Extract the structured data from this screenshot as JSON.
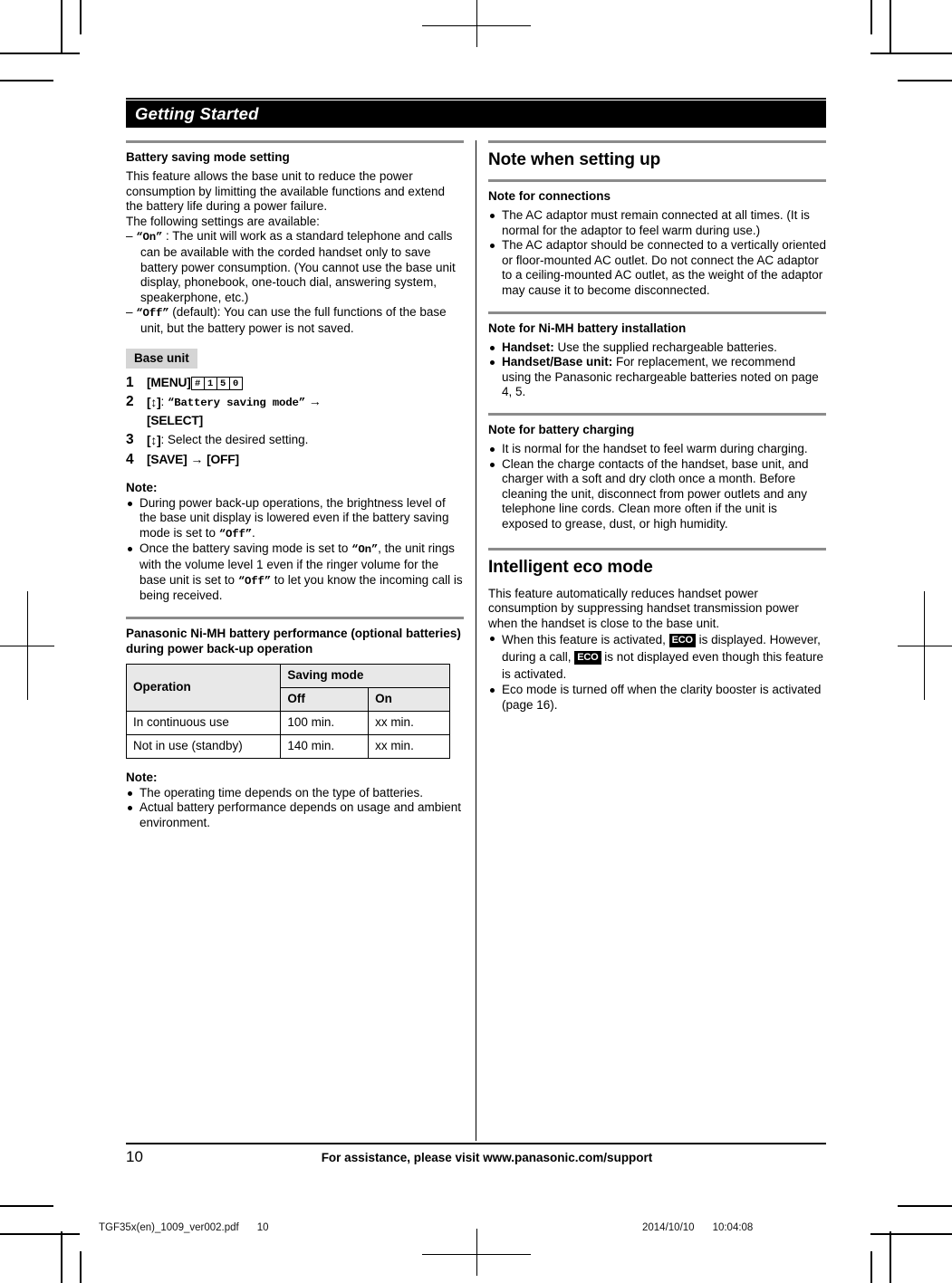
{
  "chapter": {
    "title": "Getting Started"
  },
  "left_column": {
    "section_heading": "Battery saving mode setting",
    "intro_paragraph": "This feature allows the base unit to reduce the power consumption by limitting the available functions and extend the battery life during a power failure.",
    "intro_paragraph2": "The following settings are available:",
    "options": [
      {
        "dash": "–",
        "value": "“On”",
        "text": " : The unit will work as a standard telephone and calls can be available with the corded handset only to save battery power consumption. (You cannot use the base unit display, phonebook, one-touch dial, answering system, speakerphone, etc.)"
      },
      {
        "dash": "–",
        "value": "“Off”",
        "text": " (default): You can use the full functions of the base unit, but the battery power is not saved."
      }
    ],
    "unit_tag": "Base unit",
    "steps": [
      {
        "num": "1",
        "key": "[MENU]",
        "keys": [
          "#",
          "1",
          "5",
          "0"
        ]
      },
      {
        "num": "2",
        "nav": "[↕]",
        "separator": ": ",
        "quoted": "“Battery saving mode”",
        "arrow": "→",
        "key2": "[SELECT]"
      },
      {
        "num": "3",
        "nav": "[↕]",
        "text": ": Select the desired setting."
      },
      {
        "num": "4",
        "key": "[SAVE]",
        "arrow": "→",
        "key2": "[OFF]"
      }
    ],
    "note_label_1": "Note:",
    "notes_1": [
      {
        "parts": [
          {
            "t": "During power back-up operations, the brightness level of the base unit display is lowered even if the battery saving mode is set to ",
            "s": "plain"
          },
          {
            "t": "“Off”",
            "s": "mono"
          },
          {
            "t": ".",
            "s": "plain"
          }
        ]
      },
      {
        "parts": [
          {
            "t": "Once the battery saving mode is set to ",
            "s": "plain"
          },
          {
            "t": "“On”",
            "s": "mono"
          },
          {
            "t": ", the unit rings with the volume level 1 even if the ringer volume for the base unit is set to ",
            "s": "plain"
          },
          {
            "t": "“Off”",
            "s": "mono"
          },
          {
            "t": " to let you know the incoming call is being received.",
            "s": "plain"
          }
        ]
      }
    ],
    "perf_heading": "Panasonic Ni-MH battery performance (optional batteries) during power back-up operation",
    "table": {
      "col_operation": "Operation",
      "col_group": "Saving mode",
      "col_off": "Off",
      "col_on": "On",
      "rows": [
        {
          "operation": "In continuous use",
          "off": "100 min.",
          "on": "xx min."
        },
        {
          "operation": "Not in use (standby)",
          "off": "140 min.",
          "on": "xx min."
        }
      ]
    },
    "note_label_2": "Note:",
    "notes_2": [
      "The operating time depends on the type of batteries.",
      "Actual battery performance depends on usage and ambient environment."
    ]
  },
  "right_column": {
    "section_heading": "Note when setting up",
    "connections_heading": "Note for connections",
    "connections_notes": [
      "The AC adaptor must remain connected at all times. (It is normal for the adaptor to feel warm during use.)",
      "The AC adaptor should be connected to a vertically oriented or floor-mounted AC outlet. Do not connect the AC adaptor to a ceiling-mounted AC outlet, as the weight of the adaptor may cause it to become disconnected."
    ],
    "nimh_heading": "Note for Ni-MH battery installation",
    "nimh_notes": [
      {
        "bold": "Handset:",
        "text": " Use the supplied rechargeable batteries."
      },
      {
        "bold": "Handset/Base unit:",
        "text": " For replacement, we recommend using the Panasonic rechargeable batteries noted on page 4, 5."
      }
    ],
    "charging_heading": "Note for battery charging",
    "charging_notes": [
      "It is normal for the handset to feel warm during charging.",
      "Clean the charge contacts of the handset, base unit, and charger with a soft and dry cloth once a month. Before cleaning the unit, disconnect from power outlets and any telephone line cords. Clean more often if the unit is exposed to grease, dust, or high humidity."
    ],
    "eco_heading": "Intelligent eco mode",
    "eco_intro": "This feature automatically reduces handset power consumption by suppressing handset transmission power when the handset is close to the base unit.",
    "eco_badge_label": "ECO",
    "eco_notes": [
      {
        "parts": [
          {
            "t": "When this feature is activated, ",
            "s": "plain"
          },
          {
            "t": "ECO",
            "s": "badge"
          },
          {
            "t": " is displayed. However, during a call, ",
            "s": "plain"
          },
          {
            "t": "ECO",
            "s": "badge"
          },
          {
            "t": " is not displayed even though this feature is activated.",
            "s": "plain"
          }
        ]
      },
      {
        "parts": [
          {
            "t": "Eco mode is turned off when the clarity booster is activated (page 16).",
            "s": "plain"
          }
        ]
      }
    ]
  },
  "footer": {
    "page_number": "10",
    "assistance_text": "For assistance, please visit www.panasonic.com/support"
  },
  "print_slug": {
    "filename": "TGF35x(en)_1009_ver002.pdf",
    "page": "10",
    "date": "2014/10/10",
    "time": "10:04:08"
  }
}
